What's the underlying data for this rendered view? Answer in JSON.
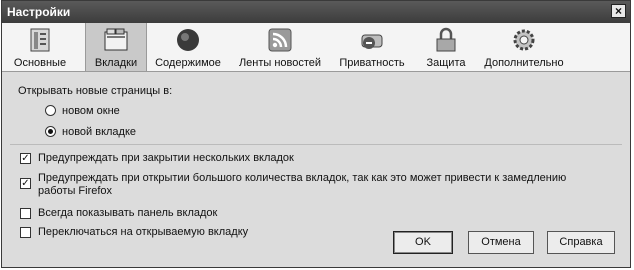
{
  "window": {
    "title": "Настройки",
    "close_glyph": "×"
  },
  "toolbar": {
    "items": [
      {
        "label": "Основные",
        "icon": "general-icon"
      },
      {
        "label": "Вкладки",
        "icon": "tabs-icon",
        "selected": true
      },
      {
        "label": "Содержимое",
        "icon": "content-icon"
      },
      {
        "label": "Ленты новостей",
        "icon": "feeds-icon"
      },
      {
        "label": "Приватность",
        "icon": "privacy-icon"
      },
      {
        "label": "Защита",
        "icon": "security-icon"
      },
      {
        "label": "Дополнительно",
        "icon": "advanced-icon"
      }
    ]
  },
  "tabs_pane": {
    "open_new_pages_label": "Открывать новые страницы в:",
    "radio_new_window": {
      "label": "новом окне",
      "selected": false
    },
    "radio_new_tab": {
      "label": "новой вкладке",
      "selected": true
    },
    "warn_close_multiple": {
      "label": "Предупреждать при закрытии нескольких вкладок",
      "checked": true
    },
    "warn_open_many_line1": "Предупреждать при открытии большого количества вкладок, так как это может привести к замедлению",
    "warn_open_many_line2": "работы Firefox",
    "warn_open_many_checked": true,
    "always_show_tabbar": {
      "label": "Всегда показывать панель вкладок",
      "checked": false
    },
    "switch_to_new_tab": {
      "label": "Переключаться на открываемую вкладку",
      "checked": false
    }
  },
  "buttons": {
    "ok": "OK",
    "cancel": "Отмена",
    "help": "Справка"
  }
}
